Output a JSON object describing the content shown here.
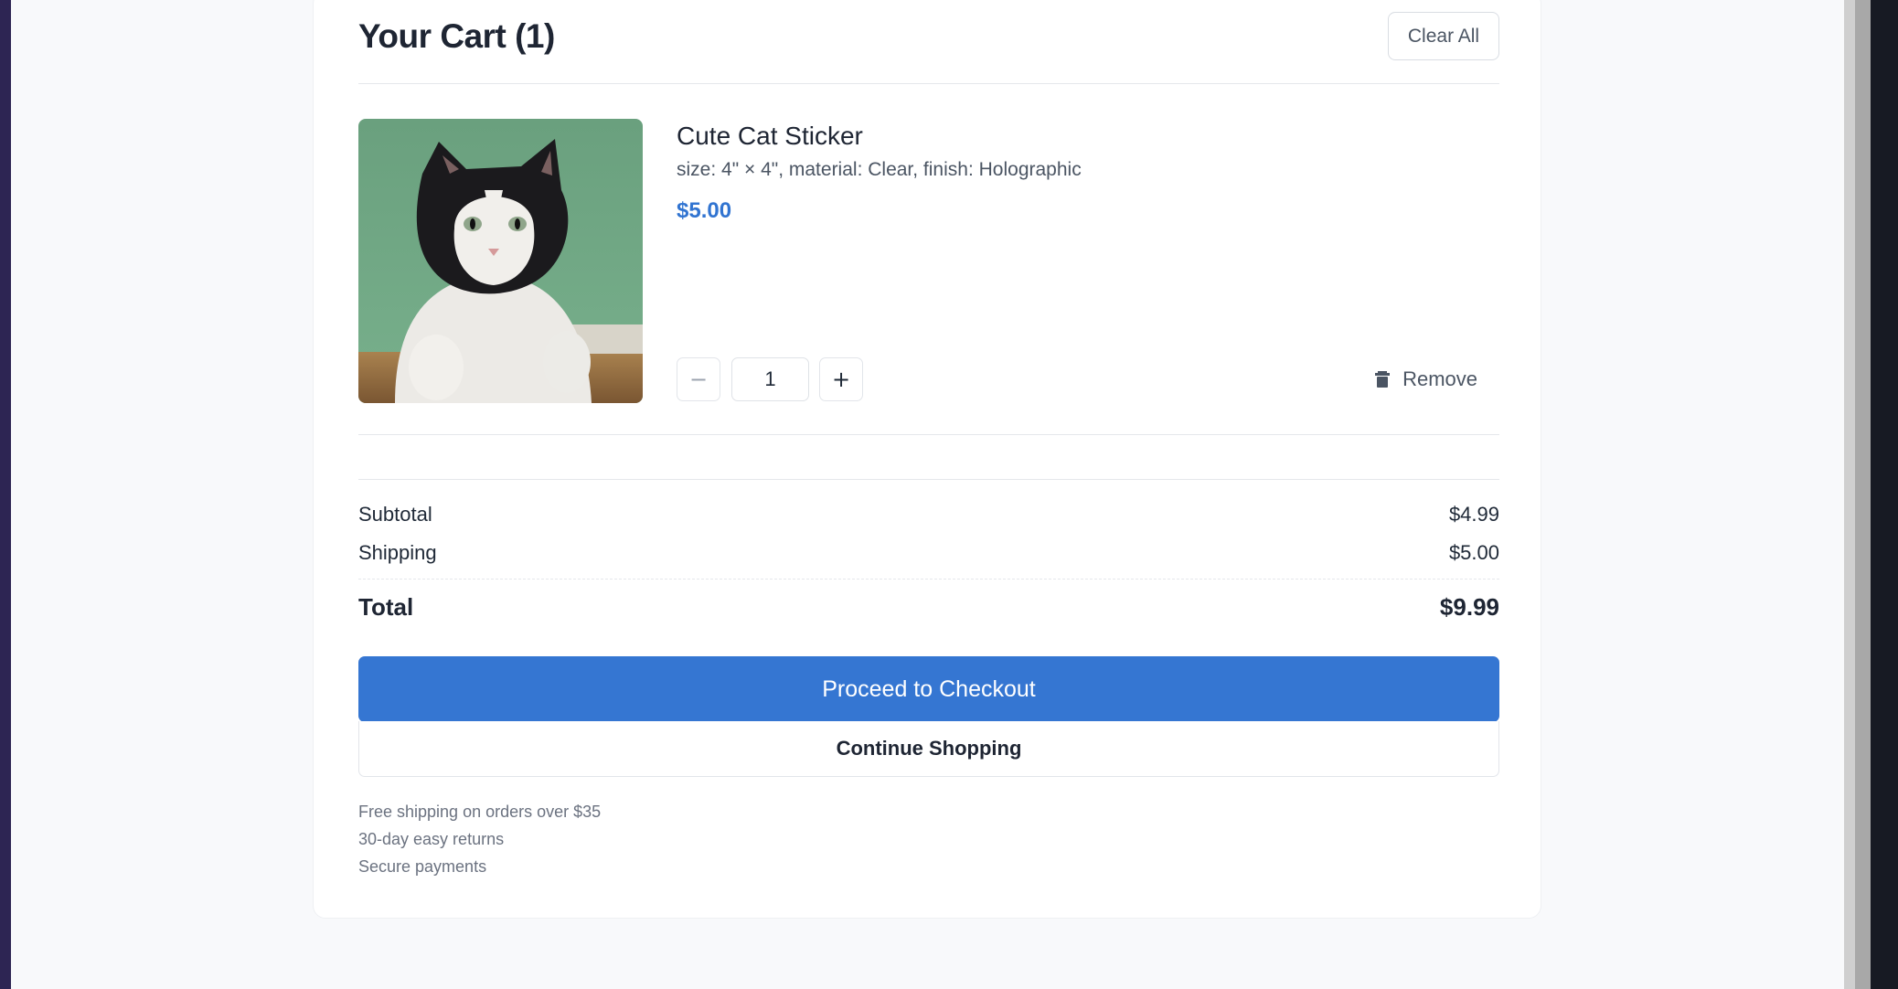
{
  "cart": {
    "title": "Your Cart (1)",
    "clear_label": "Clear All"
  },
  "item": {
    "name": "Cute Cat Sticker",
    "options": "size: 4\" × 4\", material: Clear, finish: Holographic",
    "price": "$5.00",
    "quantity": "1",
    "minus_glyph": "−",
    "plus_glyph": "+",
    "remove_label": "Remove",
    "image_icon": "cat-photo"
  },
  "summary": {
    "subtotal_label": "Subtotal",
    "subtotal_value": "$4.99",
    "shipping_label": "Shipping",
    "shipping_value": "$5.00",
    "total_label": "Total",
    "total_value": "$9.99"
  },
  "actions": {
    "checkout_label": "Proceed to Checkout",
    "continue_label": "Continue Shopping"
  },
  "perks": [
    "Free shipping on orders over $35",
    "30-day easy returns",
    "Secure payments"
  ],
  "colors": {
    "accent": "#3576d2",
    "price": "#3174d1",
    "page_bg": "#f8f9fb"
  }
}
